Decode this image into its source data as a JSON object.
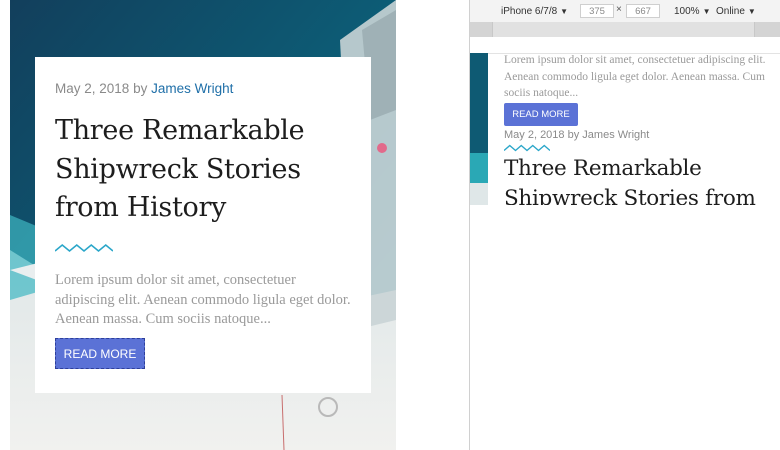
{
  "post": {
    "date": "May 2, 2018",
    "by": "by",
    "author": "James Wright",
    "title": "Three Remarkable Shipwreck Stories from History",
    "excerpt": "Lorem ipsum dolor sit amet, consectetuer adipiscing elit. Aenean commodo ligula eget dolor. Aenean massa. Cum sociis natoque...",
    "read_more_label": "READ MORE"
  },
  "devtools": {
    "device_label": "iPhone 6/7/8",
    "width": "375",
    "times": "×",
    "height": "667",
    "zoom": "100%",
    "network": "Online"
  },
  "colors": {
    "accent": "#5b72d6",
    "author_link": "#1f6fa8",
    "zigzag": "#2aa6c9"
  },
  "icons": {
    "dropdown": "caret-down-icon",
    "decorative": "zigzag-divider-icon"
  }
}
